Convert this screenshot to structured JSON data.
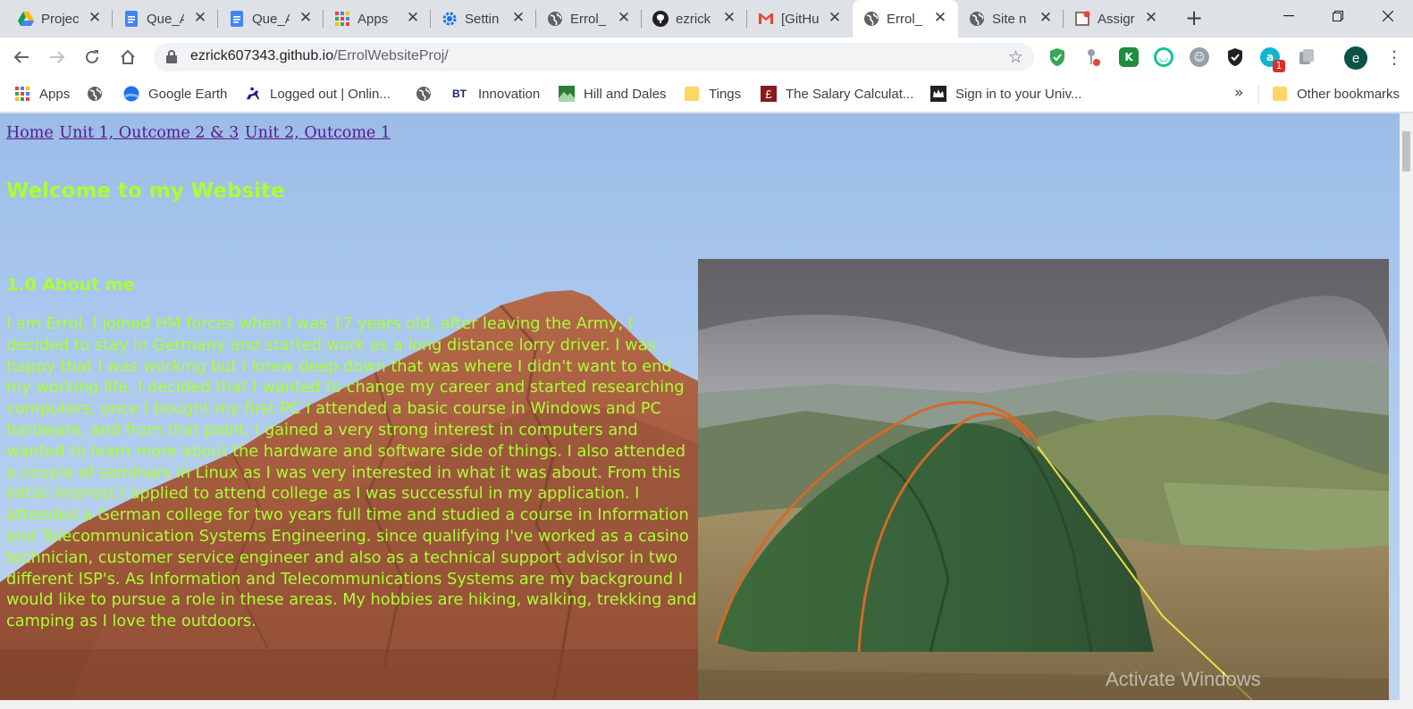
{
  "browser": {
    "tabs": [
      {
        "title": "Projec",
        "icon": "google-drive-icon"
      },
      {
        "title": "Que_A",
        "icon": "google-docs-icon"
      },
      {
        "title": "Que_A",
        "icon": "google-docs-icon"
      },
      {
        "title": "Apps",
        "icon": "apps-grid-icon"
      },
      {
        "title": "Settin",
        "icon": "gear-icon"
      },
      {
        "title": "Errol_",
        "icon": "globe-icon"
      },
      {
        "title": "ezrick",
        "icon": "github-icon"
      },
      {
        "title": "[GitHu",
        "icon": "gmail-icon"
      },
      {
        "title": "Errol_",
        "icon": "globe-icon",
        "active": true
      },
      {
        "title": "Site n",
        "icon": "globe-icon"
      },
      {
        "title": "Assigr",
        "icon": "assignment-icon"
      }
    ],
    "url_host": "ezrick607343.github.io",
    "url_path": "/ErrolWebsiteProj/",
    "extension_badge": "1",
    "profile_initial": "e",
    "bookmarks": [
      {
        "label": "Apps",
        "icon": "apps-grid-icon"
      },
      {
        "label": "",
        "icon": "globe-icon"
      },
      {
        "label": "Google Earth",
        "icon": "google-earth-icon"
      },
      {
        "label": "Logged out | Onlin...",
        "icon": "horse-rider-icon"
      },
      {
        "label": "",
        "icon": "globe-icon"
      },
      {
        "label": "Innovation",
        "icon": "bt-logo-icon"
      },
      {
        "label": "Hill and Dales",
        "icon": "hill-icon"
      },
      {
        "label": "Tings",
        "icon": "folder-icon"
      },
      {
        "label": "The Salary Calculat...",
        "icon": "pound-icon"
      },
      {
        "label": "Sign in to your Univ...",
        "icon": "crown-icon"
      }
    ],
    "bookmarks_more": "»",
    "other_bookmarks": "Other bookmarks"
  },
  "page": {
    "nav": {
      "home": "Home",
      "unit1": "Unit 1, Outcome 2 & 3",
      "unit2": "Unit 2, Outcome 1"
    },
    "welcome_heading": "Welcome to my Website",
    "about_heading": "1.0 About me",
    "about_text": "I am Errol, I joined HM forces when I was 17 years old, after leaving the Army, I decided to stay in Germany and started work as a long distance lorry driver. I was happy that I was working but I knew deep down that was where I didn't want to end my working life. I decided that I wanted to change my career and started researching computers, once I bought my first PC I attended a basic course in Windows and PC hardware, and from that point, I gained a very strong interest in computers and wanted to learn more about the hardware and software side of things. I also attended a couple of seminars in Linux as I was very interested in what it was about. From this initial interest I applied to attend college as I was successful in my application. I attended a German college for two years full time and studied a course in Information and Telecommunication Systems Engineering. since qualifying I've worked as a casino technician, customer service engineer and also as a technical support advisor in two different ISP's. As Information and Telecommunications Systems are my background I would like to pursue a role in these areas. My hobbies are hiking, walking, trekking and camping as I love the outdoors.",
    "watermark": "Activate Windows"
  },
  "colors": {
    "heading_green": "#aaff33",
    "link_visited": "#551a8b"
  }
}
